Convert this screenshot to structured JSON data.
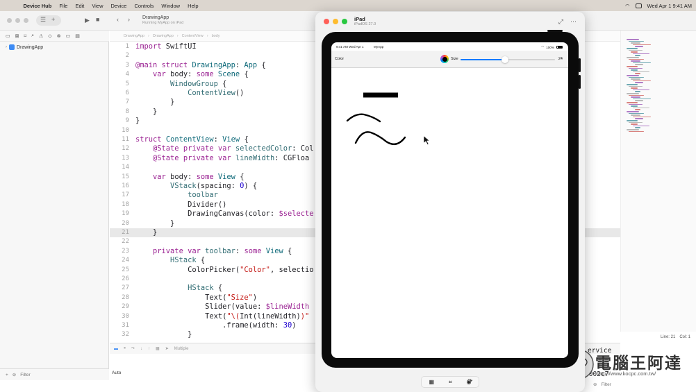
{
  "menubar": {
    "app_name": "Device Hub",
    "items": [
      "File",
      "Edit",
      "View",
      "Device",
      "Controls",
      "Window",
      "Help"
    ],
    "clock": "Wed Apr 1  9:41 AM"
  },
  "xcode": {
    "scheme": {
      "name": "DrawingApp",
      "status": "Running MyApp on iPad"
    },
    "navigator": {
      "project_name": "DrawingApp",
      "filter_placeholder": "Filter"
    },
    "breadcrumbs": [
      "DrawingApp",
      "DrawingApp",
      "ContentView",
      "body"
    ],
    "editor": {
      "current_line": 21,
      "lines": [
        {
          "n": "1",
          "html": "<span class=\"kw\">import</span> SwiftUI"
        },
        {
          "n": "2",
          "html": ""
        },
        {
          "n": "3",
          "html": "<span class=\"kw\">@main struct</span> <span class=\"ty\">DrawingApp</span>: <span class=\"ty\">App</span> {"
        },
        {
          "n": "4",
          "html": "    <span class=\"kw\">var</span> body: <span class=\"kw\">some</span> <span class=\"ty\">Scene</span> {"
        },
        {
          "n": "5",
          "html": "        <span class=\"id\">WindowGroup</span> {"
        },
        {
          "n": "6",
          "html": "            <span class=\"id\">ContentView</span>()"
        },
        {
          "n": "7",
          "html": "        }"
        },
        {
          "n": "8",
          "html": "    }"
        },
        {
          "n": "9",
          "html": "}"
        },
        {
          "n": "10",
          "html": ""
        },
        {
          "n": "11",
          "html": "<span class=\"kw\">struct</span> <span class=\"ty\">ContentView</span>: <span class=\"ty\">View</span> {"
        },
        {
          "n": "12",
          "html": "    <span class=\"kw\">@State private var</span> <span class=\"id\">selectedColor</span>: Col"
        },
        {
          "n": "13",
          "html": "    <span class=\"kw\">@State private var</span> <span class=\"id\">lineWidth</span>: CGFloa"
        },
        {
          "n": "14",
          "html": ""
        },
        {
          "n": "15",
          "html": "    <span class=\"kw\">var</span> body: <span class=\"kw\">some</span> <span class=\"ty\">View</span> {"
        },
        {
          "n": "16",
          "html": "        <span class=\"id\">VStack</span>(spacing: <span class=\"num\">0</span>) {"
        },
        {
          "n": "17",
          "html": "            <span class=\"id\">toolbar</span>"
        },
        {
          "n": "18",
          "html": "            Divider()"
        },
        {
          "n": "19",
          "html": "            DrawingCanvas(color: <span class=\"kw\">$selecte</span>"
        },
        {
          "n": "20",
          "html": "        }"
        },
        {
          "n": "21",
          "html": "    }"
        },
        {
          "n": "22",
          "html": ""
        },
        {
          "n": "23",
          "html": "    <span class=\"kw\">private var</span> <span class=\"id\">toolbar</span>: <span class=\"kw\">some</span> <span class=\"ty\">View</span> {"
        },
        {
          "n": "24",
          "html": "        <span class=\"id\">HStack</span> {"
        },
        {
          "n": "25",
          "html": "            ColorPicker(<span class=\"str\">\"Color\"</span>, selectio"
        },
        {
          "n": "26",
          "html": ""
        },
        {
          "n": "27",
          "html": "            <span class=\"id\">HStack</span> {"
        },
        {
          "n": "28",
          "html": "                Text(<span class=\"str\">\"Size\"</span>)"
        },
        {
          "n": "29",
          "html": "                Slider(value: <span class=\"kw\">$lineWidth</span>"
        },
        {
          "n": "30",
          "html": "                Text(<span class=\"str\">\"\\(</span>Int(lineWidth)<span class=\"str\">)\"</span>"
        },
        {
          "n": "31",
          "html": "                    .frame(width: <span class=\"num\">30</span>)"
        },
        {
          "n": "32",
          "html": "            }"
        }
      ]
    },
    "debug": {
      "auto_label": "Auto",
      "multiple_label": "Multiple"
    },
    "status": {
      "line": "Line: 21",
      "col": "Col: 1"
    },
    "console_snippets": {
      "top": "ervice",
      "bottom": "0002c7"
    },
    "right_filter": "Filter"
  },
  "simulator": {
    "title": "iPad",
    "subtitle": "iPadOS 27.0",
    "traffic_colors": [
      "#ff5f57",
      "#febc2e",
      "#28c840"
    ],
    "screen": {
      "status_time": "9:41 AM   Wed Apr 1",
      "status_app": "MyApp",
      "battery": "100%",
      "toolbar": {
        "color_label": "Color",
        "size_label": "Size",
        "size_value": "24",
        "slider_fraction": 0.47,
        "accent": "#007aff"
      }
    }
  },
  "watermark": {
    "title": "電腦王阿達",
    "url": "http://www.kocpc.com.tw/"
  }
}
